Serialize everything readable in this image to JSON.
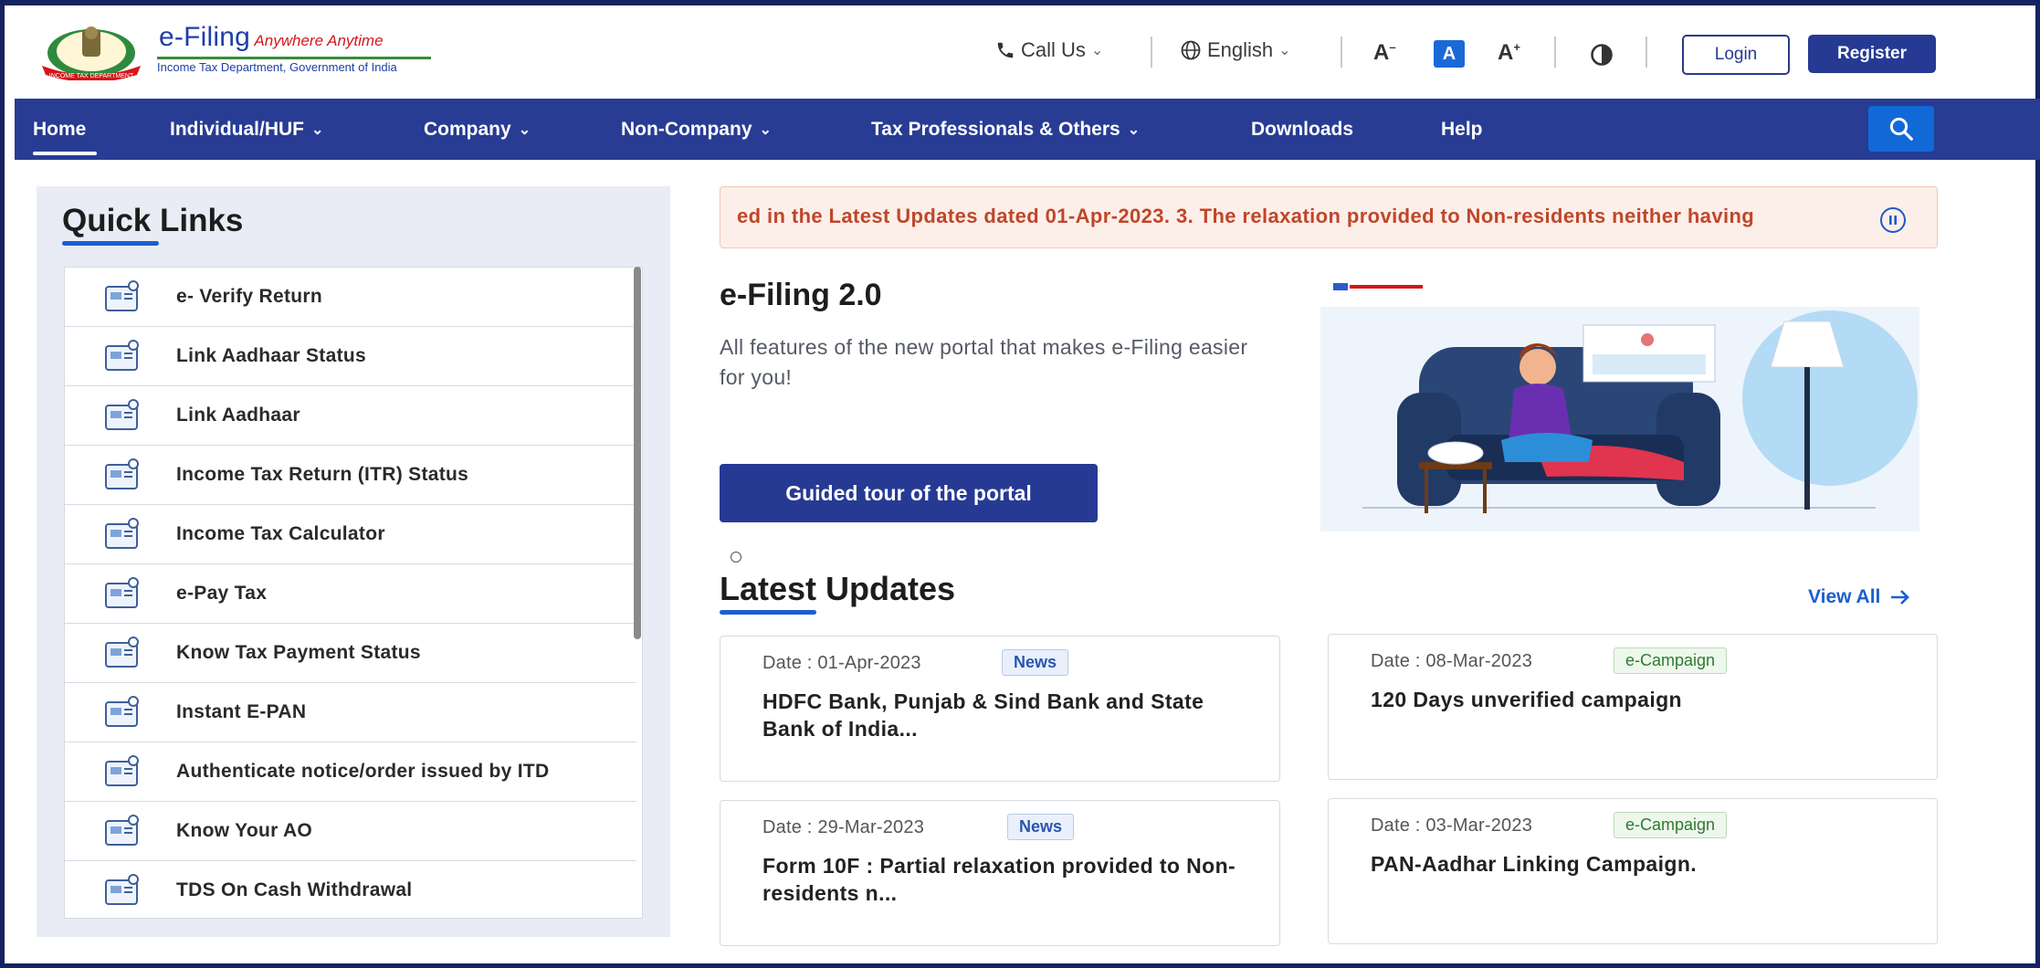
{
  "header": {
    "logo_title": "e-Filing",
    "logo_tagline": "Anywhere Anytime",
    "logo_subtitle": "Income Tax Department, Government of India",
    "call_us": "Call Us",
    "language": "English",
    "font_decrease": "A",
    "font_normal": "A",
    "font_increase": "A",
    "login": "Login",
    "register": "Register"
  },
  "nav": {
    "items": [
      {
        "label": "Home"
      },
      {
        "label": "Individual/HUF"
      },
      {
        "label": "Company"
      },
      {
        "label": "Non-Company"
      },
      {
        "label": "Tax Professionals & Others"
      },
      {
        "label": "Downloads"
      },
      {
        "label": "Help"
      }
    ],
    "search_icon": "search-icon"
  },
  "quick_links": {
    "title": "Quick Links",
    "items": [
      {
        "label": "e- Verify Return",
        "icon": "verify-return-icon"
      },
      {
        "label": "Link Aadhaar Status",
        "icon": "aadhaar-status-icon"
      },
      {
        "label": "Link Aadhaar",
        "icon": "link-aadhaar-icon"
      },
      {
        "label": "Income Tax Return (ITR) Status",
        "icon": "itr-status-icon"
      },
      {
        "label": "Income Tax Calculator",
        "icon": "calculator-icon"
      },
      {
        "label": "e-Pay Tax",
        "icon": "pay-tax-icon"
      },
      {
        "label": "Know Tax Payment Status",
        "icon": "payment-status-icon"
      },
      {
        "label": "Instant E-PAN",
        "icon": "epan-icon"
      },
      {
        "label": "Authenticate notice/order issued by ITD",
        "icon": "authenticate-icon"
      },
      {
        "label": "Know Your AO",
        "icon": "know-ao-icon"
      },
      {
        "label": "TDS On Cash Withdrawal",
        "icon": "tds-icon"
      }
    ]
  },
  "ticker": {
    "text": "ed in the Latest Updates dated 01-Apr-2023. 3. The relaxation provided to Non-residents neither having"
  },
  "hero": {
    "title": "e-Filing 2.0",
    "description": "All  features of the new portal that makes e-Filing easier for you!",
    "button": "Guided tour of the portal"
  },
  "latest_updates": {
    "title": "Latest Updates",
    "view_all": "View All",
    "cards": [
      {
        "date": "Date : 01-Apr-2023",
        "badge": "News",
        "text": "HDFC Bank, Punjab & Sind Bank and State Bank of India..."
      },
      {
        "date": "Date : 08-Mar-2023",
        "badge": "e-Campaign",
        "text": "120 Days unverified campaign"
      },
      {
        "date": "Date : 29-Mar-2023",
        "badge": "News",
        "text": "Form 10F : Partial relaxation provided to Non-residents n..."
      },
      {
        "date": "Date : 03-Mar-2023",
        "badge": "e-Campaign",
        "text": "PAN-Aadhar Linking Campaign."
      }
    ]
  },
  "colors": {
    "nav_bg": "#283c93",
    "accent_blue": "#1b5fd0",
    "ticker_text": "#c0462a",
    "campaign_green": "#2f7a2f"
  }
}
